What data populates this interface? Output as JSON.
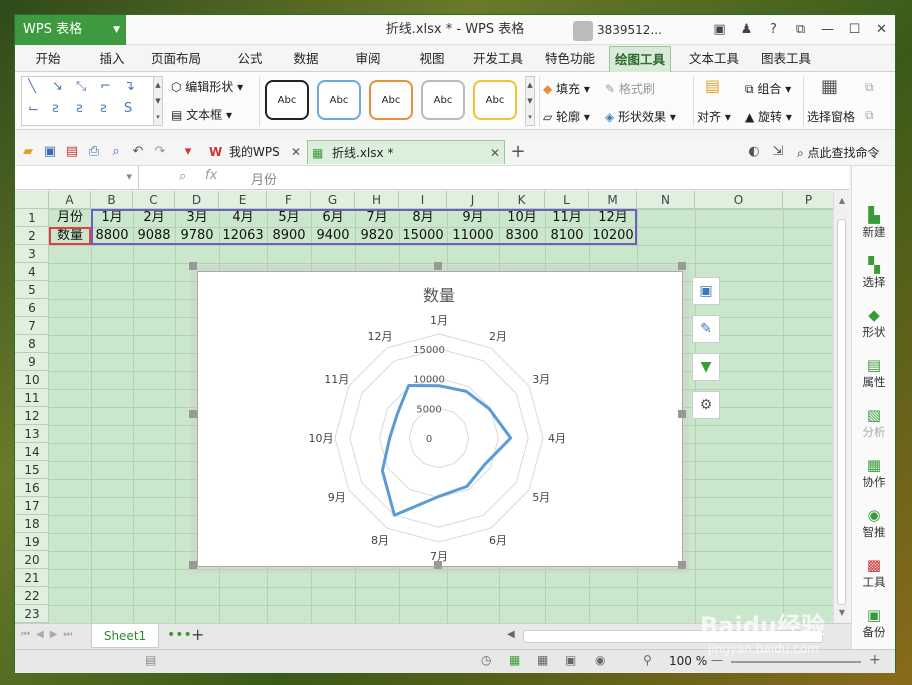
{
  "app": {
    "name": "WPS 表格",
    "title": "折线.xlsx * - WPS 表格",
    "user": "3839512..."
  },
  "tabs": [
    "开始",
    "插入",
    "页面布局",
    "公式",
    "数据",
    "审阅",
    "视图",
    "开发工具",
    "特色功能",
    "绘图工具",
    "文本工具",
    "图表工具"
  ],
  "active_tab": "绘图工具",
  "ribbon": {
    "edit_shape": "编辑形状",
    "text_box": "文本框",
    "style_label": "Abc",
    "fill": "填充",
    "format_brush": "格式刷",
    "outline": "轮廓",
    "shape_effect": "形状效果",
    "combine": "组合",
    "align": "对齐",
    "rotate": "旋转",
    "select_pane": "选择窗格"
  },
  "doc_tabs": {
    "my_wps": "我的WPS",
    "file": "折线.xlsx *"
  },
  "search_cmd": "点此查找命令",
  "formula_bar": {
    "cell_value": "月份",
    "fx": "fx"
  },
  "columns": [
    "A",
    "B",
    "C",
    "D",
    "E",
    "F",
    "G",
    "H",
    "I",
    "J",
    "K",
    "L",
    "M",
    "N",
    "O",
    "P"
  ],
  "rows": [
    "1",
    "2",
    "3",
    "4",
    "5",
    "6",
    "7",
    "8",
    "9",
    "10",
    "11",
    "12",
    "13",
    "14",
    "15",
    "16",
    "17",
    "18",
    "19",
    "20",
    "21",
    "22",
    "23"
  ],
  "table": {
    "row1": [
      "月份",
      "1月",
      "2月",
      "3月",
      "4月",
      "5月",
      "6月",
      "7月",
      "8月",
      "9月",
      "10月",
      "11月",
      "12月"
    ],
    "row2": [
      "数量",
      "8800",
      "9088",
      "9780",
      "12063",
      "8900",
      "9400",
      "9820",
      "15000",
      "11000",
      "8300",
      "8100",
      "10200"
    ]
  },
  "chart_data": {
    "type": "radar",
    "title": "数量",
    "categories": [
      "1月",
      "2月",
      "3月",
      "4月",
      "5月",
      "6月",
      "7月",
      "8月",
      "9月",
      "10月",
      "11月",
      "12月"
    ],
    "series": [
      {
        "values": [
          8800,
          9088,
          9780,
          12063,
          8900,
          9400,
          9820,
          15000,
          11000,
          8300,
          8100,
          10200
        ]
      }
    ],
    "ticks": [
      "0",
      "5000",
      "10000",
      "15000"
    ],
    "rmax": 17500,
    "color": "#5b9bd5"
  },
  "right_panel": [
    "新建",
    "选择",
    "形状",
    "属性",
    "分析",
    "协作",
    "智推",
    "工具",
    "备份"
  ],
  "sheet": {
    "name": "Sheet1"
  },
  "status": {
    "zoom": "100 %"
  },
  "watermark": {
    "text": "Baidu经验",
    "url": "jingyan.baidu.com"
  }
}
